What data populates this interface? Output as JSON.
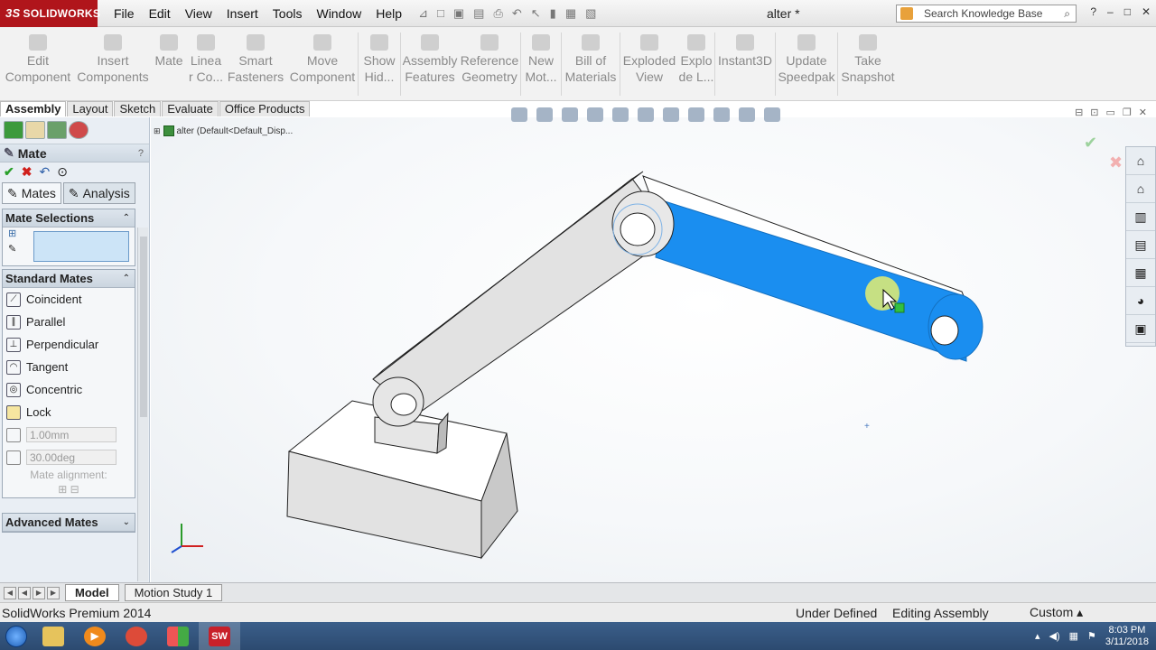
{
  "app": {
    "brand": "SOLIDWORKS",
    "brand_prefix": "3S",
    "doc_title": "alter *"
  },
  "menu": [
    "File",
    "Edit",
    "View",
    "Insert",
    "Tools",
    "Window",
    "Help"
  ],
  "search": {
    "placeholder": "Search Knowledge Base"
  },
  "window_controls": [
    "?",
    "–",
    "□",
    "✕"
  ],
  "ribbon": [
    {
      "label": "Edit\nComponent"
    },
    {
      "label": "Insert\nComponents"
    },
    {
      "label": "Mate"
    },
    {
      "label": "Linea\nr Co..."
    },
    {
      "label": "Smart\nFasteners"
    },
    {
      "label": "Move\nComponent"
    },
    {
      "label": "Show\nHid..."
    },
    {
      "label": "Assembly\nFeatures"
    },
    {
      "label": "Reference\nGeometry"
    },
    {
      "label": "New\nMot..."
    },
    {
      "label": "Bill of\nMaterials"
    },
    {
      "label": "Exploded\nView"
    },
    {
      "label": "Explo\nde L..."
    },
    {
      "label": "Instant3D"
    },
    {
      "label": "Update\nSpeedpak"
    },
    {
      "label": "Take\nSnapshot"
    }
  ],
  "cm_tabs": [
    "Assembly",
    "Layout",
    "Sketch",
    "Evaluate",
    "Office Products"
  ],
  "property_manager": {
    "title": "Mate",
    "help": "?",
    "tabs": [
      "Mates",
      "Analysis"
    ],
    "mate_selections": "Mate Selections",
    "standard_mates": "Standard Mates",
    "mates": [
      {
        "label": "Coincident",
        "icon": "coincident-icon"
      },
      {
        "label": "Parallel",
        "icon": "parallel-icon"
      },
      {
        "label": "Perpendicular",
        "icon": "perpendicular-icon"
      },
      {
        "label": "Tangent",
        "icon": "tangent-icon"
      },
      {
        "label": "Concentric",
        "icon": "concentric-icon"
      },
      {
        "label": "Lock",
        "icon": "lock-icon"
      }
    ],
    "distance_value": "1.00mm",
    "angle_value": "30.00deg",
    "mate_alignment": "Mate alignment:",
    "advanced_mates": "Advanced Mates"
  },
  "tree": {
    "root": "alter  (Default<Default_Disp..."
  },
  "bottom_tabs": [
    "Model",
    "Motion Study 1"
  ],
  "status": {
    "product": "SolidWorks Premium 2014",
    "definition": "Under Defined",
    "mode": "Editing Assembly",
    "units": "Custom"
  },
  "taskbar": {
    "time": "8:03 PM",
    "date": "3/11/2018"
  },
  "colors": {
    "brand": "#b0151b",
    "selection": "#1a8ef0"
  }
}
